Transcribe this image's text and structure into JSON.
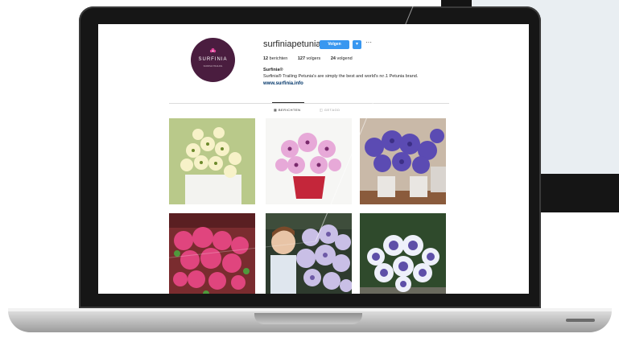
{
  "profile": {
    "avatar_brand": "SURFINIA",
    "avatar_tagline": "SURFINIA TRAILING",
    "username": "surfiniapetunia",
    "follow_label": "Volgen",
    "dropdown_glyph": "▾",
    "more_glyph": "···",
    "stats": [
      {
        "count": "12",
        "label": "berichten"
      },
      {
        "count": "127",
        "label": "volgers"
      },
      {
        "count": "24",
        "label": "volgend"
      }
    ],
    "bio_name": "Surfinia®",
    "bio_text": "Surfinia® Trailing Petunia's are simply the best and world's no.1 Petunia brand.",
    "bio_link": "www.surfinia.info"
  },
  "tabs": [
    {
      "label": "▦ BERICHTEN"
    },
    {
      "label": "◫ GETAGD"
    }
  ],
  "posts": [
    {
      "subject": "white-yellow-petunia-basket"
    },
    {
      "subject": "pink-petunia-pot"
    },
    {
      "subject": "purple-petunia-pots"
    },
    {
      "subject": "pink-petunia-hanging"
    },
    {
      "subject": "girl-with-lavender-petunias"
    },
    {
      "subject": "blue-white-petunia-mound"
    }
  ],
  "colors": {
    "follow_blue": "#3897f0",
    "avatar_purple": "#4a1d3f",
    "link_blue": "#003569"
  }
}
